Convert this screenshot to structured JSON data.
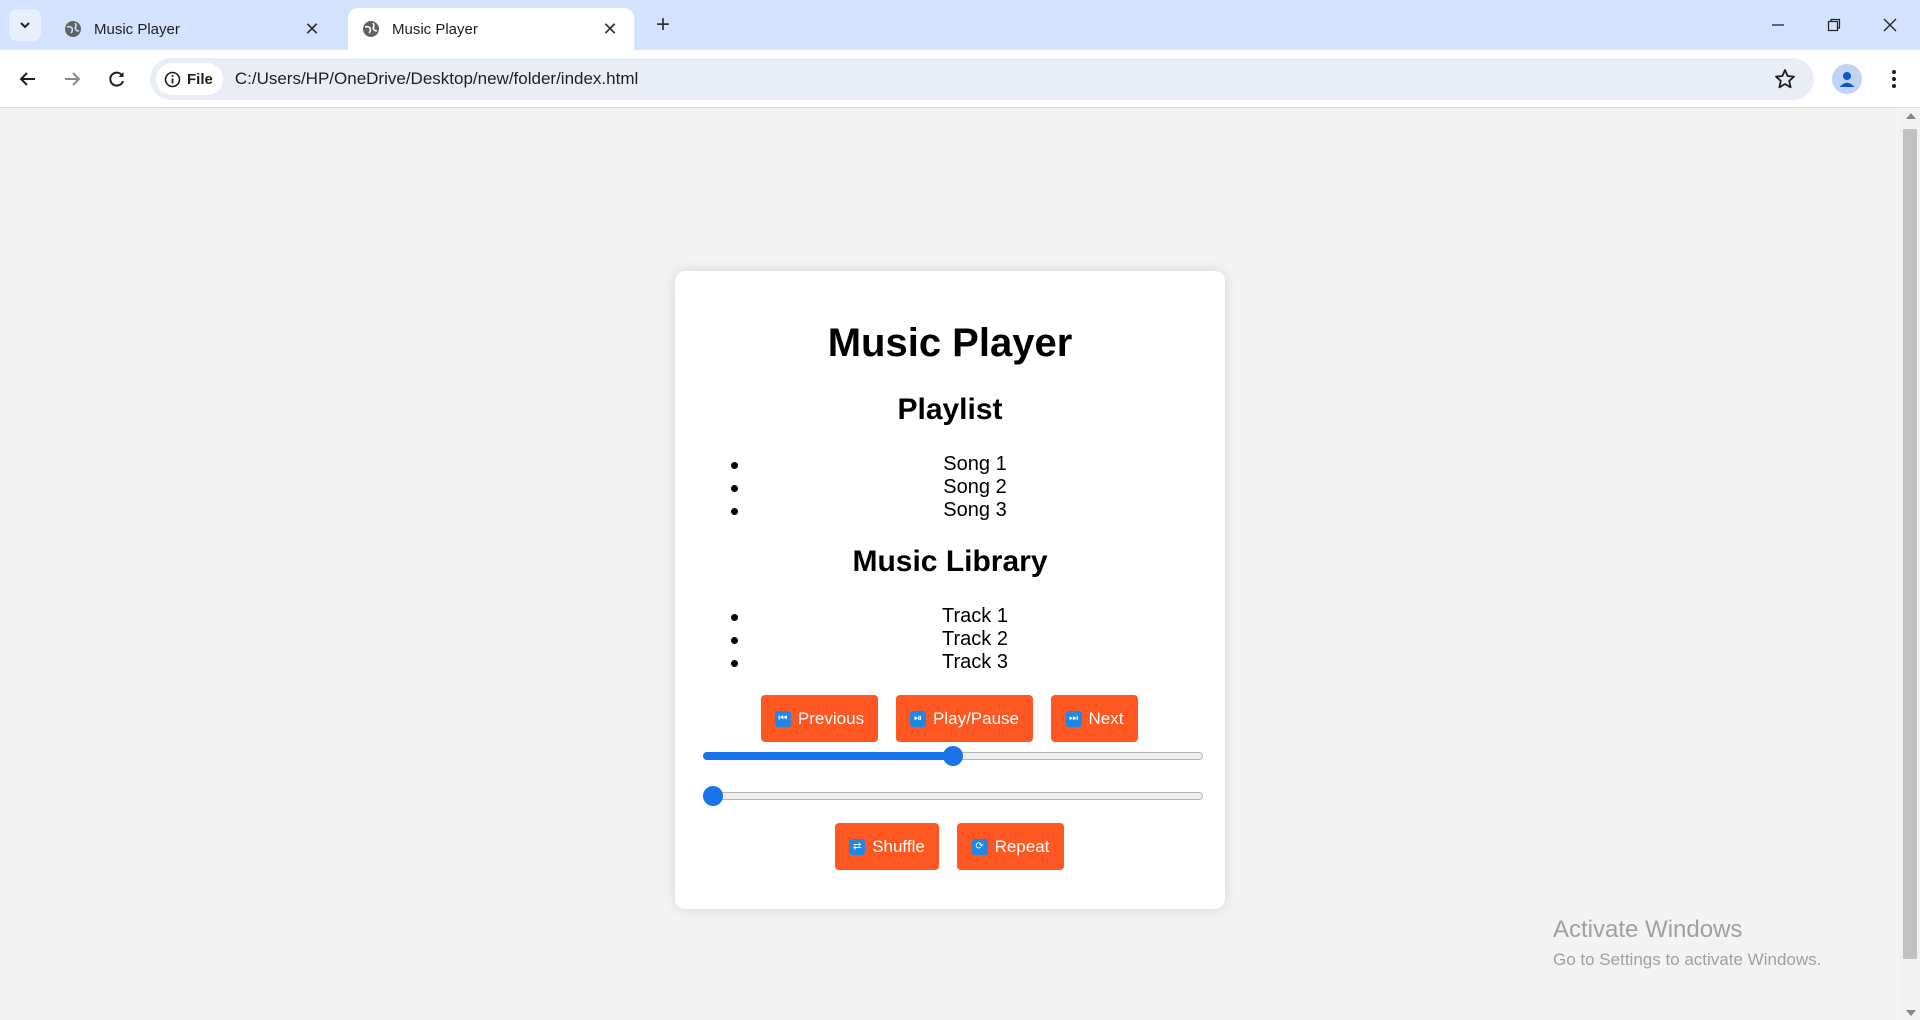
{
  "browser": {
    "tabs": [
      {
        "title": "Music Player",
        "active": false
      },
      {
        "title": "Music Player",
        "active": true
      }
    ],
    "address": {
      "site_chip": "File",
      "url": "C:/Users/HP/OneDrive/Desktop/new/folder/index.html"
    }
  },
  "page": {
    "title": "Music Player",
    "playlist": {
      "heading": "Playlist",
      "items": [
        "Song 1",
        "Song 2",
        "Song 3"
      ]
    },
    "library": {
      "heading": "Music Library",
      "items": [
        "Track 1",
        "Track 2",
        "Track 3"
      ]
    },
    "controls": {
      "previous": "Previous",
      "play_pause": "Play/Pause",
      "next": "Next"
    },
    "sliders": {
      "first_value_fraction": 0.5,
      "second_value_fraction": 0.0
    },
    "modes": {
      "shuffle": "Shuffle",
      "repeat": "Repeat"
    },
    "accent_color": "#ff5722",
    "slider_color": "#1a73e8"
  },
  "watermark": {
    "line1": "Activate Windows",
    "line2": "Go to Settings to activate Windows."
  }
}
